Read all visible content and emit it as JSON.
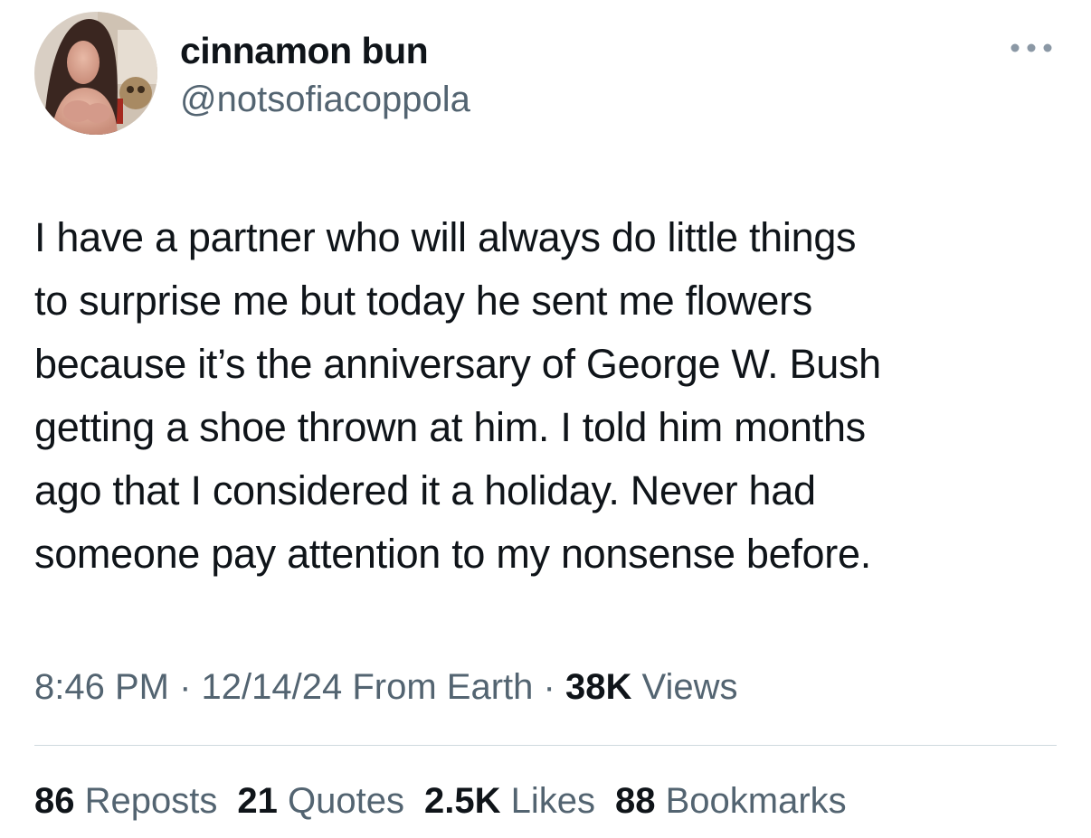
{
  "author": {
    "display_name": "cinnamon bun",
    "handle": "@notsofiacoppola"
  },
  "more_icon": "more-horizontal-icon",
  "tweet": {
    "text": "I have a partner who will always do little things\nto surprise me but today he sent me flowers\nbecause it’s the anniversary of George W. Bush\ngetting a shoe thrown at him. I told him months\nago that I considered it a holiday. Never had\nsomeone pay attention to my nonsense before."
  },
  "meta": {
    "time": "8:46 PM",
    "date": "12/14/24",
    "source": "From Earth",
    "separator": "·",
    "views_count": "38K",
    "views_label": "Views"
  },
  "stats": {
    "reposts": {
      "count": "86",
      "label": "Reposts"
    },
    "quotes": {
      "count": "21",
      "label": "Quotes"
    },
    "likes": {
      "count": "2.5K",
      "label": "Likes"
    },
    "bookmarks": {
      "count": "88",
      "label": "Bookmarks"
    }
  },
  "colors": {
    "text_primary": "#0f1419",
    "text_secondary": "#536471",
    "divider": "#cfd9de",
    "background": "#ffffff"
  }
}
